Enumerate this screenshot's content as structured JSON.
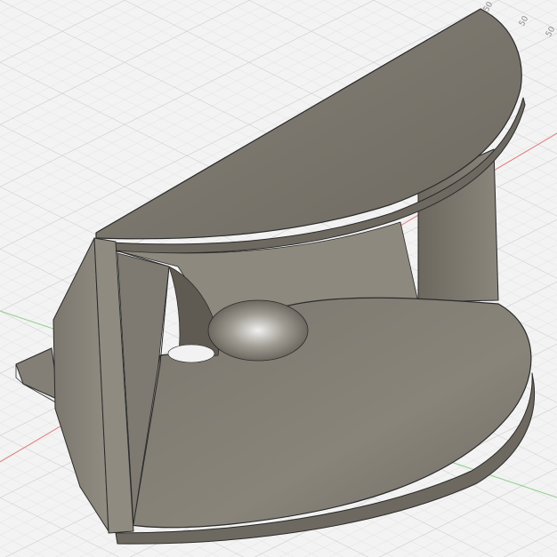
{
  "viewport": {
    "background_color": "#f3f3f3",
    "grid_minor_color": "#d9d9d9",
    "grid_major_color": "#c4c4c4",
    "x_axis_color": "#e07a7a",
    "y_axis_color": "#8fcf8f",
    "model_color": "#7a766c",
    "edge_color": "#2b2b2b"
  },
  "ruler": {
    "tick_labels": [
      "50",
      "50",
      "50"
    ]
  }
}
